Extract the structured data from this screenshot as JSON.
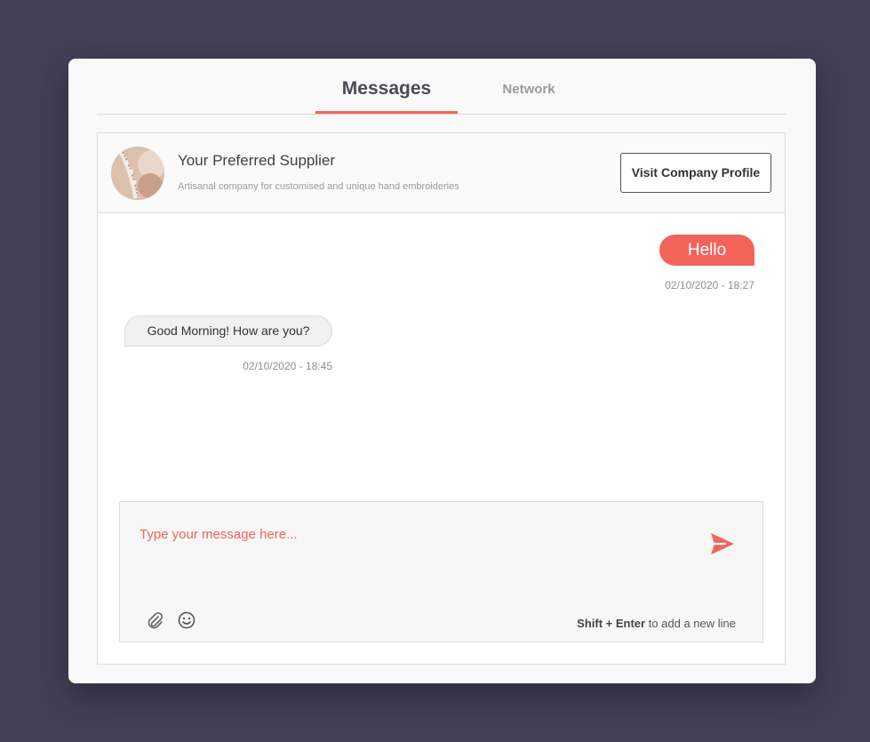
{
  "tabs": [
    {
      "label": "Messages",
      "active": true
    },
    {
      "label": "Network",
      "active": false
    }
  ],
  "chat_header": {
    "name": "Your Preferred Supplier",
    "description": "Artisanal company for customised and unique hand embroideries",
    "profile_button": "Visit Company Profile"
  },
  "messages": [
    {
      "direction": "sent",
      "text": "Hello",
      "time": "02/10/2020 - 18:27"
    },
    {
      "direction": "received",
      "text": "Good Morning! How are you?",
      "time": "02/10/2020 - 18:45"
    }
  ],
  "composer": {
    "placeholder": "Type your message here...",
    "hint_keys": "Shift + Enter",
    "hint_text": " to add a new line",
    "icons": [
      "paperclip-icon",
      "smiley-icon",
      "send-icon"
    ]
  },
  "colors": {
    "background": "#434057",
    "accent": "#f2645a",
    "card": "#f9f9f9"
  }
}
